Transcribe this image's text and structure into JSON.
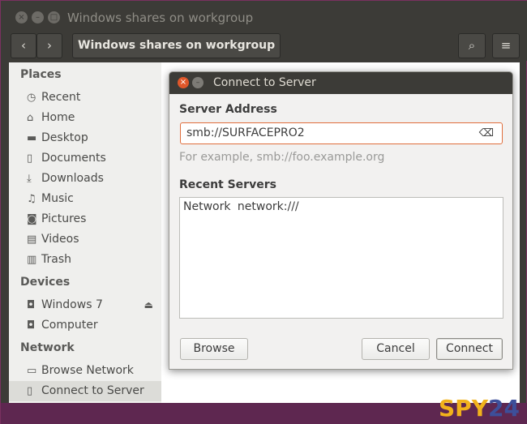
{
  "window": {
    "title": "Windows shares on workgroup",
    "close_glyph": "×",
    "min_glyph": "–",
    "max_glyph": "□"
  },
  "toolbar": {
    "back_glyph": "‹",
    "forward_glyph": "›",
    "path_label": "Windows shares on workgroup",
    "search_glyph": "⌕",
    "menu_glyph": "≡"
  },
  "sidebar": {
    "places_header": "Places",
    "places": [
      {
        "label": "Recent",
        "icon": "◷"
      },
      {
        "label": "Home",
        "icon": "⌂"
      },
      {
        "label": "Desktop",
        "icon": "▬"
      },
      {
        "label": "Documents",
        "icon": "▯"
      },
      {
        "label": "Downloads",
        "icon": "⤓"
      },
      {
        "label": "Music",
        "icon": "♫"
      },
      {
        "label": "Pictures",
        "icon": "◙"
      },
      {
        "label": "Videos",
        "icon": "▤"
      },
      {
        "label": "Trash",
        "icon": "▥"
      }
    ],
    "devices_header": "Devices",
    "devices": [
      {
        "label": "Windows 7",
        "icon": "◘"
      },
      {
        "label": "Computer",
        "icon": "◘"
      }
    ],
    "eject_glyph": "⏏",
    "network_header": "Network",
    "network": [
      {
        "label": "Browse Network",
        "icon": "▭"
      },
      {
        "label": "Connect to Server",
        "icon": "▯"
      }
    ]
  },
  "dialog": {
    "title": "Connect to Server",
    "close_glyph": "×",
    "min_glyph": "–",
    "server_address_label": "Server Address",
    "server_address_value": "smb://SURFACEPRO2",
    "clear_glyph": "⌫",
    "hint": "For example, smb://foo.example.org",
    "recent_label": "Recent Servers",
    "recent_items": [
      {
        "name": "Network",
        "uri": "network:///"
      }
    ],
    "browse_label": "Browse",
    "cancel_label": "Cancel",
    "connect_label": "Connect"
  },
  "watermark": {
    "part1": "SPY",
    "part2": "24"
  },
  "colors": {
    "accent": "#e06e3c",
    "title_bar": "#3c3b37",
    "desktop": "#5e2750"
  }
}
